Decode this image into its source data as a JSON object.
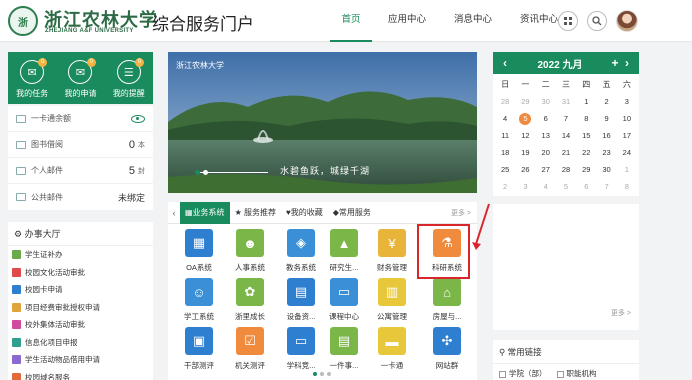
{
  "header": {
    "logo_text_cn": "浙江农林大学",
    "logo_text_en": "ZHEJIANG A&F UNIVERSITY",
    "title": "综合服务门户",
    "nav": [
      "首页",
      "应用中心",
      "消息中心",
      "资讯中心"
    ],
    "active_nav": "首页",
    "icons": [
      "grid-icon",
      "search-icon"
    ]
  },
  "user_quick": [
    {
      "label": "我的任务",
      "icon": "mail-icon",
      "badge": "0"
    },
    {
      "label": "我的申请",
      "icon": "mail-icon",
      "badge": "0"
    },
    {
      "label": "我的提醒",
      "icon": "chat-icon",
      "badge": "0"
    }
  ],
  "info": {
    "card": {
      "label": "一卡通余额"
    },
    "library": {
      "label": "图书借阅",
      "value": "0",
      "unit": "本"
    },
    "mail": {
      "label": "个人邮件",
      "value": "5",
      "unit": "封"
    },
    "public_mail": {
      "label": "公共邮件",
      "value": "未绑定"
    }
  },
  "banshi": {
    "title": "办事大厅",
    "items": [
      {
        "label": "学生证补办",
        "color": "#6aaa4a"
      },
      {
        "label": "校园文化活动审批",
        "color": "#e04a4a"
      },
      {
        "label": "校园卡申请",
        "color": "#2f7fd0"
      },
      {
        "label": "项目经费审批授权申请",
        "color": "#e0a43a"
      },
      {
        "label": "校外集体活动审批",
        "color": "#d04aa0"
      },
      {
        "label": "信息化项目申报",
        "color": "#2f9f8f"
      },
      {
        "label": "学生活动物品借用申请",
        "color": "#8a6ad0"
      },
      {
        "label": "校园域名服务",
        "color": "#e06a3a"
      }
    ]
  },
  "carousel": {
    "logo_text": "浙江农林大学",
    "caption": "水碧鱼跃，城绿千湖"
  },
  "tabs": {
    "items": [
      "业务系统",
      "服务推荐",
      "我的收藏",
      "常用服务"
    ],
    "active": "业务系统",
    "more": "更多 >"
  },
  "apps": [
    {
      "label": "OA系统",
      "color": "#2f7fd0",
      "icon": "building-icon"
    },
    {
      "label": "人事系统",
      "color": "#7ab648",
      "icon": "person-icon"
    },
    {
      "label": "教务系统",
      "color": "#3a8fd6",
      "icon": "graduation-icon"
    },
    {
      "label": "研究生...",
      "color": "#7ab648",
      "icon": "graduation-cap-icon"
    },
    {
      "label": "财务管理",
      "color": "#e8b53a",
      "icon": "money-icon"
    },
    {
      "label": "科研系统",
      "color": "#f08a3c",
      "icon": "microscope-icon"
    },
    {
      "label": "学工系统",
      "color": "#3a8fd6",
      "icon": "people-icon"
    },
    {
      "label": "浙里成长",
      "color": "#7ab648",
      "icon": "growth-icon"
    },
    {
      "label": "设备资...",
      "color": "#2f7fd0",
      "icon": "inbox-icon"
    },
    {
      "label": "课程中心",
      "color": "#3a8fd6",
      "icon": "book-icon"
    },
    {
      "label": "公寓管理",
      "color": "#e8c83a",
      "icon": "apartment-icon"
    },
    {
      "label": "房屋与...",
      "color": "#7ab648",
      "icon": "house-icon"
    },
    {
      "label": "干部测评",
      "color": "#2f7fd0",
      "icon": "chart-icon"
    },
    {
      "label": "机关测评",
      "color": "#f08a3c",
      "icon": "checklist-icon"
    },
    {
      "label": "学科竞...",
      "color": "#2f7fd0",
      "icon": "monitor-icon"
    },
    {
      "label": "一件事...",
      "color": "#7ab648",
      "icon": "document-icon"
    },
    {
      "label": "一卡通",
      "color": "#e8c83a",
      "icon": "card-icon"
    },
    {
      "label": "网站群",
      "color": "#2f7fd0",
      "icon": "network-icon"
    }
  ],
  "calendar": {
    "title": "2022 九月",
    "weekdays": [
      "日",
      "一",
      "二",
      "三",
      "四",
      "五",
      "六"
    ],
    "today": "5",
    "days": [
      {
        "d": "28",
        "dim": true
      },
      {
        "d": "29",
        "dim": true
      },
      {
        "d": "30",
        "dim": true
      },
      {
        "d": "31",
        "dim": true
      },
      {
        "d": "1"
      },
      {
        "d": "2"
      },
      {
        "d": "3"
      },
      {
        "d": "4"
      },
      {
        "d": "5"
      },
      {
        "d": "6"
      },
      {
        "d": "7"
      },
      {
        "d": "8"
      },
      {
        "d": "9"
      },
      {
        "d": "10"
      },
      {
        "d": "11"
      },
      {
        "d": "12"
      },
      {
        "d": "13"
      },
      {
        "d": "14"
      },
      {
        "d": "15"
      },
      {
        "d": "16"
      },
      {
        "d": "17"
      },
      {
        "d": "18"
      },
      {
        "d": "19"
      },
      {
        "d": "20"
      },
      {
        "d": "21"
      },
      {
        "d": "22"
      },
      {
        "d": "23"
      },
      {
        "d": "24"
      },
      {
        "d": "25"
      },
      {
        "d": "26"
      },
      {
        "d": "27"
      },
      {
        "d": "28"
      },
      {
        "d": "29"
      },
      {
        "d": "30"
      },
      {
        "d": "1",
        "dim": true
      },
      {
        "d": "2",
        "dim": true
      },
      {
        "d": "3",
        "dim": true
      },
      {
        "d": "4",
        "dim": true
      },
      {
        "d": "5",
        "dim": true
      },
      {
        "d": "6",
        "dim": true
      },
      {
        "d": "7",
        "dim": true
      },
      {
        "d": "8",
        "dim": true
      }
    ]
  },
  "right_panel": {
    "more": "更多 >"
  },
  "links": {
    "title": "常用链接",
    "items": [
      "学院（部）",
      "职能机构"
    ]
  },
  "colors": {
    "brand": "#1a8b5c",
    "highlight": "#d9262c"
  }
}
